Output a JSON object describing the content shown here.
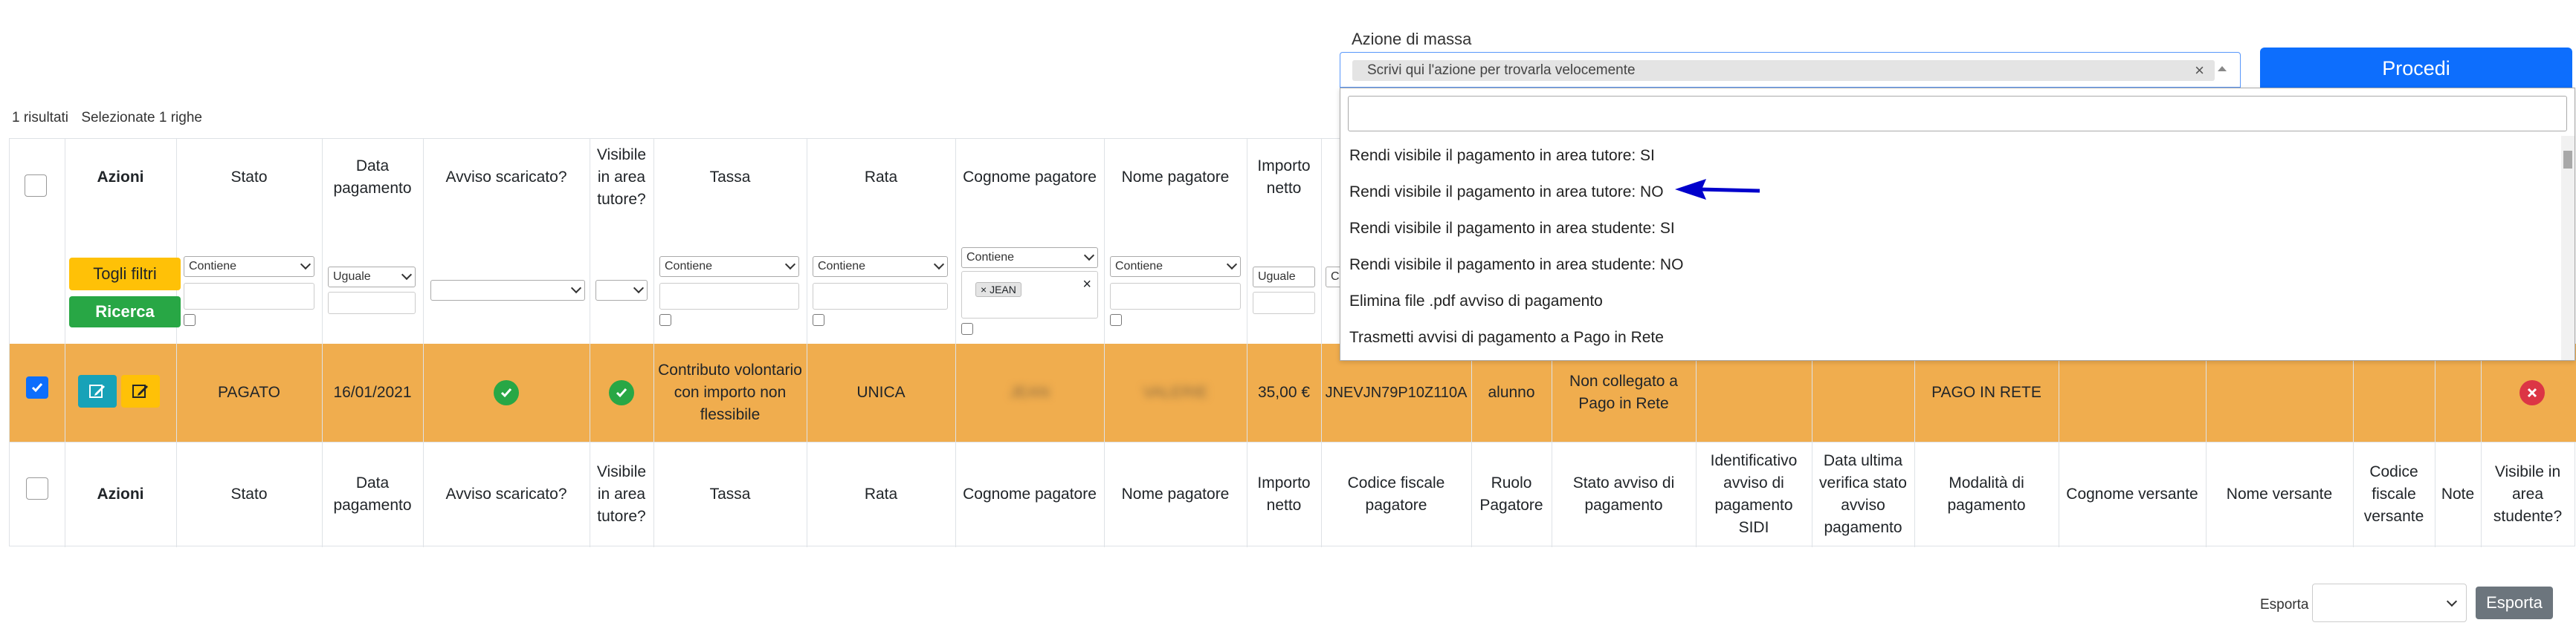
{
  "summary": {
    "results": "1 risultati",
    "selected": "Selezionate 1 righe"
  },
  "mass_action": {
    "label": "Azione di massa",
    "placeholder_tag": "Scrivi qui l'azione per trovarla velocemente",
    "tag_remove": "×",
    "proceed": "Procedi",
    "options": [
      "Rendi visibile il pagamento in area tutore: SI",
      "Rendi visibile il pagamento in area tutore: NO",
      "Rendi visibile il pagamento in area studente: SI",
      "Rendi visibile il pagamento in area studente: NO",
      "Elimina file .pdf avviso di pagamento",
      "Trasmetti avvisi di pagamento a Pago in Rete"
    ],
    "highlighted_option_index": 1,
    "arrow_color": "#0000cc"
  },
  "table": {
    "headers": [
      "Azioni",
      "Stato",
      "Data pagamento",
      "Avviso scaricato?",
      "Visibile in area tutore?",
      "Tassa",
      "Rata",
      "Cognome pagatore",
      "Nome pagatore",
      "Importo netto"
    ],
    "footer_headers": [
      "Azioni",
      "Stato",
      "Data pagamento",
      "Avviso scaricato?",
      "Visibile in area tutore?",
      "Tassa",
      "Rata",
      "Cognome pagatore",
      "Nome pagatore",
      "Importo netto",
      "Codice fiscale pagatore",
      "Ruolo Pagatore",
      "Stato avviso di pagamento",
      "Identificativo avviso di pagamento SIDI",
      "Data ultima verifica stato avviso pagamento",
      "Modalità di pagamento",
      "Cognome versante",
      "Nome versante",
      "Codice fiscale versante",
      "Note",
      "Visibile in area studente?"
    ],
    "filters": {
      "clear": "Togli filtri",
      "search": "Ricerca",
      "stato": "Contiene",
      "data": "Uguale",
      "tassa": "Contiene",
      "rata": "Contiene",
      "cognome": "Contiene",
      "cognome_tag": "JEAN",
      "cognome_tag_x": "×",
      "cognome_clear": "×",
      "nome": "Contiene",
      "importo": "Uguale",
      "codice_partial": "C"
    },
    "row": {
      "stato": "PAGATO",
      "data": "16/01/2021",
      "tassa": "Contributo volontario con importo non flessibile",
      "rata": "UNICA",
      "cognome": "JEAN",
      "nome": "VALERIE",
      "importo": "35,00 €",
      "codice_fiscale": "JNEVJN79P10Z110A",
      "ruolo": "alunno",
      "stato_avviso": "Non collegato a Pago in Rete",
      "modalita": "PAGO IN RETE",
      "row_color": "#f0ad4e"
    }
  },
  "export": {
    "label": "Esporta",
    "button": "Esporta"
  }
}
